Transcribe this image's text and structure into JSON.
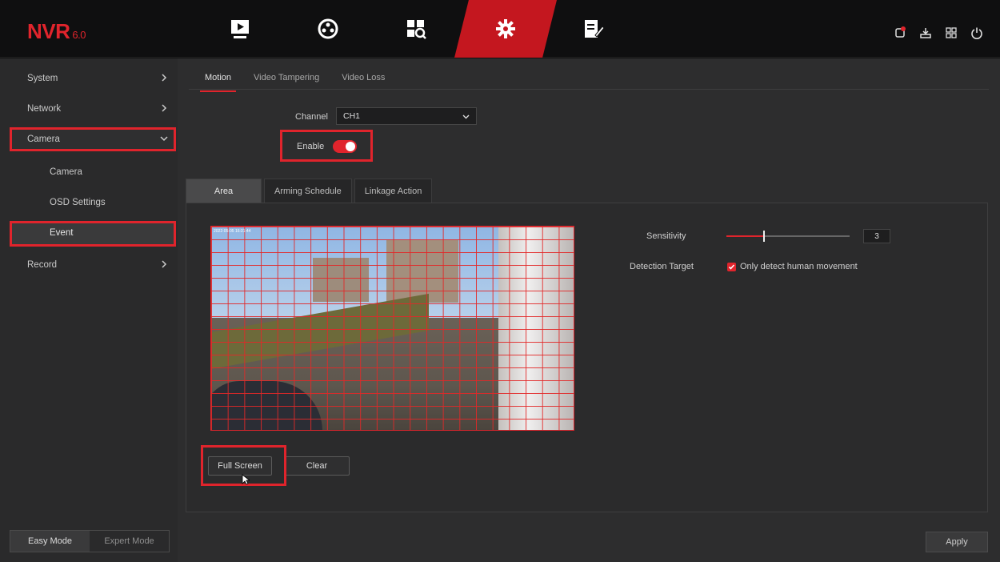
{
  "app": {
    "logo_text": "NVR",
    "logo_version": "6.0",
    "accent": "#e0242c"
  },
  "topnav": [
    {
      "icon": "playback-icon"
    },
    {
      "icon": "dial-icon"
    },
    {
      "icon": "search-icon"
    },
    {
      "icon": "settings-gear-icon",
      "active": true
    },
    {
      "icon": "edit-form-icon"
    }
  ],
  "status_icons": [
    "alarm-icon",
    "download-icon",
    "grid-icon",
    "power-icon"
  ],
  "sidebar": {
    "items": [
      {
        "label": "System"
      },
      {
        "label": "Network"
      },
      {
        "label": "Camera",
        "expanded": true
      },
      {
        "label": "Camera"
      },
      {
        "label": "OSD Settings"
      },
      {
        "label": "Event",
        "selected": true
      },
      {
        "label": "Record"
      }
    ],
    "mode": {
      "easy": "Easy Mode",
      "expert": "Expert Mode",
      "active": "easy"
    }
  },
  "main": {
    "tabs": [
      {
        "label": "Motion",
        "active": true
      },
      {
        "label": "Video Tampering"
      },
      {
        "label": "Video Loss"
      }
    ],
    "channel": {
      "label": "Channel",
      "value": "CH1"
    },
    "enable": {
      "label": "Enable",
      "on": true
    },
    "subtabs": [
      {
        "label": "Area",
        "active": true
      },
      {
        "label": "Arming Schedule"
      },
      {
        "label": "Linkage Action"
      }
    ],
    "video": {
      "osd": "2022-05-05 16:31:44"
    },
    "sensitivity": {
      "label": "Sensitivity",
      "value": "3",
      "fraction": 0.3
    },
    "detection": {
      "label": "Detection Target",
      "checkbox_label": "Only detect human movement",
      "checked": true
    },
    "buttons": {
      "full_screen": "Full Screen",
      "clear": "Clear",
      "apply": "Apply"
    }
  }
}
